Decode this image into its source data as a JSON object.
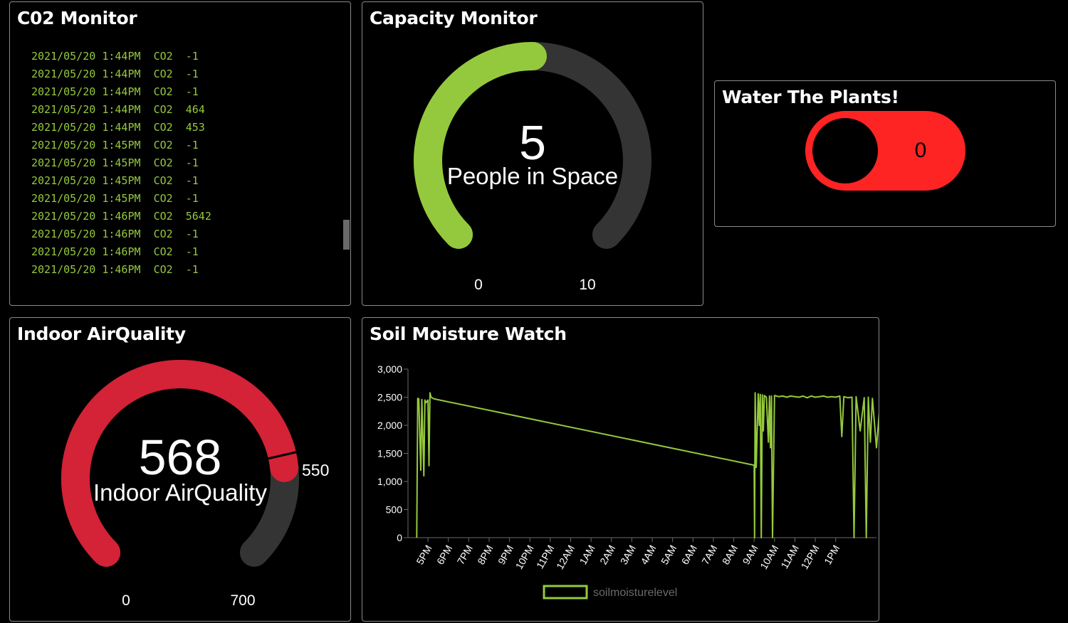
{
  "co2": {
    "title": "C02 Monitor",
    "log": [
      {
        "time": "2021/05/20 1:44PM",
        "label": "CO2",
        "value": "-1"
      },
      {
        "time": "2021/05/20 1:44PM",
        "label": "CO2",
        "value": "-1"
      },
      {
        "time": "2021/05/20 1:44PM",
        "label": "CO2",
        "value": "-1"
      },
      {
        "time": "2021/05/20 1:44PM",
        "label": "CO2",
        "value": "464"
      },
      {
        "time": "2021/05/20 1:44PM",
        "label": "CO2",
        "value": "453"
      },
      {
        "time": "2021/05/20 1:45PM",
        "label": "CO2",
        "value": "-1"
      },
      {
        "time": "2021/05/20 1:45PM",
        "label": "CO2",
        "value": "-1"
      },
      {
        "time": "2021/05/20 1:45PM",
        "label": "CO2",
        "value": "-1"
      },
      {
        "time": "2021/05/20 1:45PM",
        "label": "CO2",
        "value": "-1"
      },
      {
        "time": "2021/05/20 1:46PM",
        "label": "CO2",
        "value": "5642"
      },
      {
        "time": "2021/05/20 1:46PM",
        "label": "CO2",
        "value": "-1"
      },
      {
        "time": "2021/05/20 1:46PM",
        "label": "CO2",
        "value": "-1"
      },
      {
        "time": "2021/05/20 1:46PM",
        "label": "CO2",
        "value": "-1"
      }
    ]
  },
  "capacity": {
    "title": "Capacity Monitor",
    "value": "5",
    "label": "People in Space",
    "min": "0",
    "max": "10",
    "level": 5,
    "range": [
      0,
      10
    ],
    "fill_color": "#95c93d",
    "track_color": "#343434"
  },
  "water": {
    "title": "Water The Plants!",
    "value": "0",
    "on": false,
    "color": "#ff2424"
  },
  "air": {
    "title": "Indoor AirQuality",
    "value": "568",
    "label": "Indoor AirQuality",
    "min": "0",
    "max": "700",
    "threshold_label": "550",
    "level": 568,
    "threshold": 550,
    "range": [
      0,
      700
    ],
    "fill_color": "#d42236",
    "track_color": "#343434"
  },
  "soil": {
    "title": "Soil Moisture Watch",
    "chart_data": {
      "type": "line",
      "title": "",
      "xlabel": "",
      "ylabel": "",
      "ylim": [
        0,
        3000
      ],
      "yticks": [
        0,
        500,
        1000,
        1500,
        2000,
        2500,
        3000
      ],
      "ytick_labels": [
        "0",
        "500",
        "1,000",
        "1,500",
        "2,000",
        "2,500",
        "3,000"
      ],
      "xticks": [
        "5PM",
        "6PM",
        "7PM",
        "8PM",
        "9PM",
        "10PM",
        "11PM",
        "12AM",
        "1AM",
        "2AM",
        "3AM",
        "4AM",
        "5AM",
        "6AM",
        "7AM",
        "8AM",
        "9AM",
        "10AM",
        "11AM",
        "12PM",
        "1PM"
      ],
      "grid": false,
      "legend_position": "bottom",
      "series": [
        {
          "name": "soilmoisturelevel",
          "color": "#95c93d",
          "x_hours": [
            -0.55,
            -0.5,
            -0.45,
            -0.35,
            -0.3,
            -0.2,
            -0.15,
            -0.1,
            0,
            0.05,
            0.1,
            0.15,
            0.2,
            0.25,
            0.3,
            16.0,
            16.02,
            16.05,
            16.1,
            16.2,
            16.25,
            16.3,
            16.35,
            16.4,
            16.45,
            16.5,
            16.6,
            16.7,
            16.75,
            16.8,
            16.85,
            16.9,
            17.0,
            17.2,
            17.4,
            17.6,
            17.8,
            18.0,
            18.2,
            18.4,
            18.6,
            18.8,
            19.0,
            19.2,
            19.4,
            19.6,
            19.8,
            20.0,
            20.2,
            20.3,
            20.4,
            20.6,
            20.8,
            20.9,
            21.0,
            21.2,
            21.4,
            21.5,
            21.6,
            21.7,
            21.8,
            22.0,
            22.2,
            22.4,
            22.6,
            22.8
          ],
          "y": [
            0,
            2480,
            2470,
            1200,
            2460,
            1100,
            2450,
            2400,
            2450,
            1280,
            2580,
            2500,
            2490,
            2480,
            2470,
            1290,
            0,
            2580,
            1250,
            2560,
            2000,
            2550,
            0,
            2540,
            1900,
            2530,
            2500,
            1700,
            2520,
            1600,
            2520,
            0,
            2530,
            2510,
            2520,
            2500,
            2520,
            2510,
            2500,
            2520,
            2490,
            2520,
            2500,
            2510,
            2520,
            2500,
            2510,
            2500,
            2520,
            1800,
            2510,
            2490,
            2500,
            0,
            2510,
            1900,
            2490,
            0,
            2500,
            1700,
            2480,
            1600,
            2500,
            1250,
            2490,
            2480
          ]
        }
      ]
    }
  }
}
